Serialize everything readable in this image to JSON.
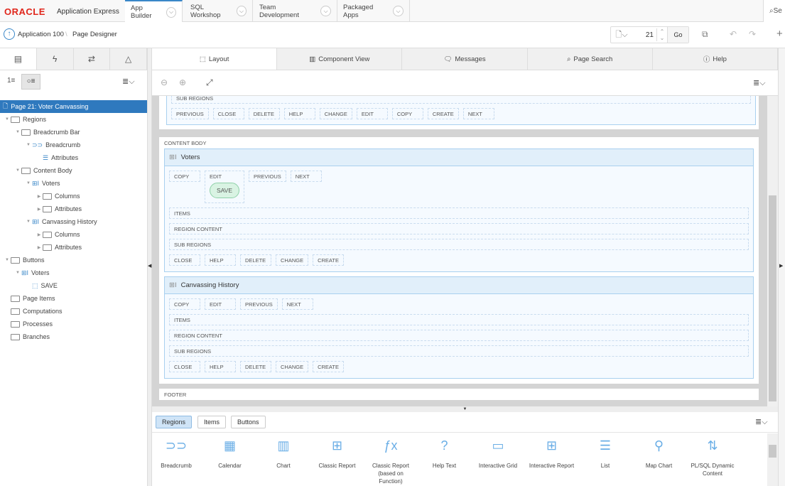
{
  "header": {
    "logo": "ORACLE",
    "product": "Application Express",
    "tabs": [
      "App Builder",
      "SQL Workshop",
      "Team Development",
      "Packaged Apps"
    ],
    "search_label": "Se"
  },
  "breadcrumb": [
    "Application 100",
    "Page Designer"
  ],
  "toolbar": {
    "page_number": "21",
    "go_label": "Go"
  },
  "tree": [
    {
      "label": "Page 21: Voter Canvassing",
      "level": 0,
      "icon": "page-icon",
      "selected": true
    },
    {
      "label": "Regions",
      "level": 0,
      "icon": "folder-open-icon",
      "tw": "▼"
    },
    {
      "label": "Breadcrumb Bar",
      "level": 1,
      "icon": "folder-open-icon",
      "tw": "▼"
    },
    {
      "label": "Breadcrumb",
      "level": 2,
      "icon": "breadcrumb-icon",
      "tw": "▼"
    },
    {
      "label": "Attributes",
      "level": 3,
      "icon": "list-icon"
    },
    {
      "label": "Content Body",
      "level": 1,
      "icon": "folder-open-icon",
      "tw": "▼"
    },
    {
      "label": "Voters",
      "level": 2,
      "icon": "grid-icon",
      "tw": "▼"
    },
    {
      "label": "Columns",
      "level": 3,
      "icon": "folder-icon",
      "tw": "▶"
    },
    {
      "label": "Attributes",
      "level": 3,
      "icon": "folder-icon",
      "tw": "▶"
    },
    {
      "label": "Canvassing History",
      "level": 2,
      "icon": "grid-icon",
      "tw": "▼"
    },
    {
      "label": "Columns",
      "level": 3,
      "icon": "folder-icon",
      "tw": "▶"
    },
    {
      "label": "Attributes",
      "level": 3,
      "icon": "folder-icon",
      "tw": "▶"
    },
    {
      "label": "Buttons",
      "level": 0,
      "icon": "folder-open-icon",
      "tw": "▼"
    },
    {
      "label": "Voters",
      "level": 1,
      "icon": "grid-icon",
      "tw": "▼"
    },
    {
      "label": "SAVE",
      "level": 2,
      "icon": "button-icon"
    },
    {
      "label": "Page Items",
      "level": 0,
      "icon": "folder-icon"
    },
    {
      "label": "Computations",
      "level": 0,
      "icon": "folder-icon"
    },
    {
      "label": "Processes",
      "level": 0,
      "icon": "folder-icon"
    },
    {
      "label": "Branches",
      "level": 0,
      "icon": "folder-icon"
    }
  ],
  "center_tabs": [
    "Layout",
    "Component View",
    "Messages",
    "Page Search",
    "Help"
  ],
  "layout": {
    "breadcrumb_bar": {
      "sub_regions": "SUB REGIONS",
      "buttons": [
        "PREVIOUS",
        "CLOSE",
        "DELETE",
        "HELP",
        "CHANGE",
        "EDIT",
        "COPY",
        "CREATE",
        "NEXT"
      ]
    },
    "content_body": {
      "title": "CONTENT BODY",
      "voters": {
        "title": "Voters",
        "top_buttons": [
          "COPY",
          "EDIT",
          "PREVIOUS",
          "NEXT"
        ],
        "save": "SAVE",
        "items": "ITEMS",
        "region_content": "REGION CONTENT",
        "sub_regions": "SUB REGIONS",
        "bottom_buttons": [
          "CLOSE",
          "HELP",
          "DELETE",
          "CHANGE",
          "CREATE"
        ]
      },
      "history": {
        "title": "Canvassing History",
        "top_buttons": [
          "COPY",
          "EDIT",
          "PREVIOUS",
          "NEXT"
        ],
        "items": "ITEMS",
        "region_content": "REGION CONTENT",
        "sub_regions": "SUB REGIONS",
        "bottom_buttons": [
          "CLOSE",
          "HELP",
          "DELETE",
          "CHANGE",
          "CREATE"
        ]
      }
    },
    "footer": "FOOTER"
  },
  "gallery": {
    "tabs": [
      "Regions",
      "Items",
      "Buttons"
    ],
    "items": [
      {
        "label": "Breadcrumb",
        "icon": "⊃⊃"
      },
      {
        "label": "Calendar",
        "icon": "▦"
      },
      {
        "label": "Chart",
        "icon": "▥"
      },
      {
        "label": "Classic Report",
        "icon": "⊞"
      },
      {
        "label": "Classic Report (based on Function)",
        "icon": "ƒx"
      },
      {
        "label": "Help Text",
        "icon": "?"
      },
      {
        "label": "Interactive Grid",
        "icon": "▭"
      },
      {
        "label": "Interactive Report",
        "icon": "⊞"
      },
      {
        "label": "List",
        "icon": "☰"
      },
      {
        "label": "Map Chart",
        "icon": "⚲"
      },
      {
        "label": "PL/SQL Dynamic Content",
        "icon": "⇅"
      }
    ]
  }
}
